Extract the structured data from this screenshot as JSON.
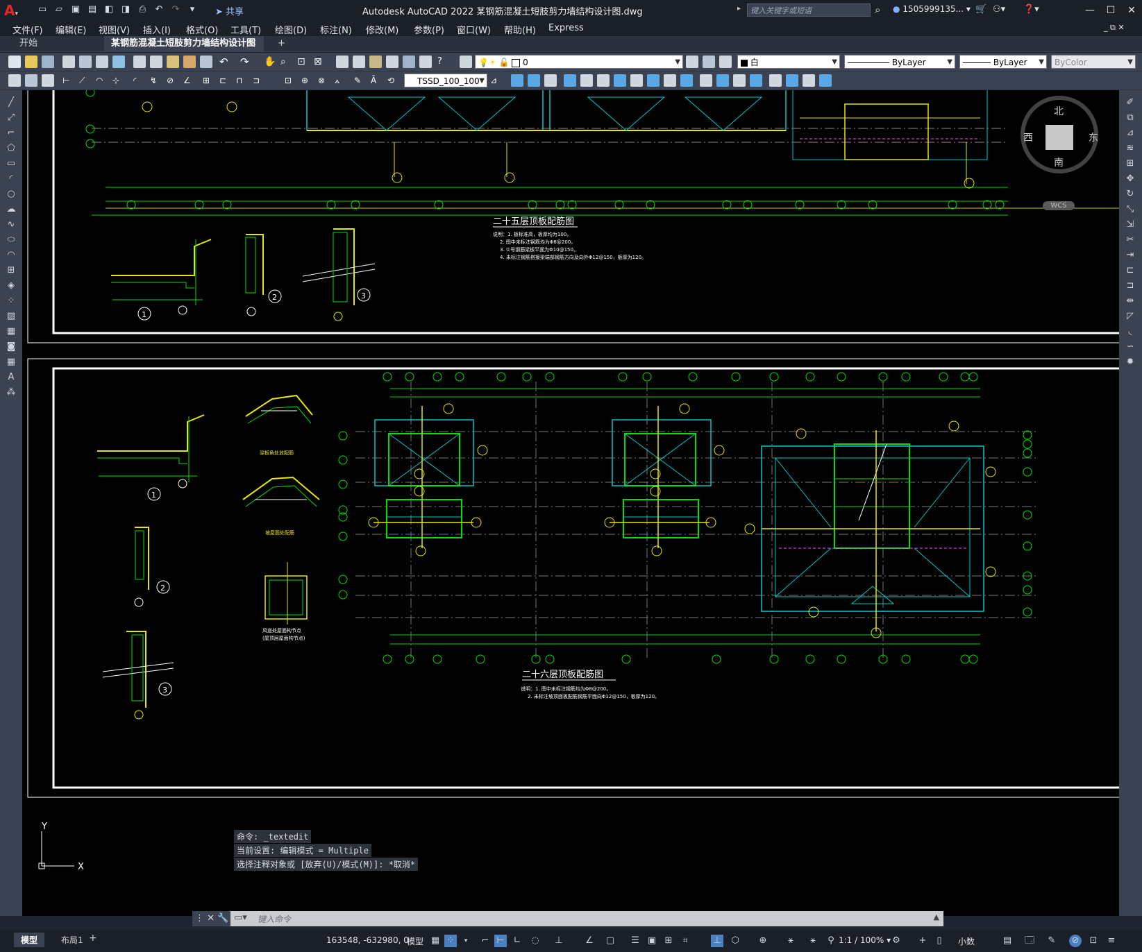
{
  "title_bar": {
    "app_title": "Autodesk AutoCAD 2022    某钢筋混凝土短肢剪力墙结构设计图.dwg",
    "share_label": "共享",
    "search_placeholder": "键入关键字或短语",
    "user": "1505999135... ▾"
  },
  "menu": [
    "文件(F)",
    "编辑(E)",
    "视图(V)",
    "插入(I)",
    "格式(O)",
    "工具(T)",
    "绘图(D)",
    "标注(N)",
    "修改(M)",
    "参数(P)",
    "窗口(W)",
    "帮助(H)",
    "Express"
  ],
  "tabs": {
    "start": "开始",
    "active": "某钢筋混凝土短肢剪力墙结构设计图*",
    "plus": "+"
  },
  "toolbar": {
    "layer": "0",
    "color": "白",
    "linetype": "ByLayer",
    "lineweight": "ByLayer",
    "plotstyle": "ByColor",
    "dimstyle": "TSSD_100_100"
  },
  "viewcube": {
    "north": "北",
    "south": "南",
    "east": "东",
    "west": "西",
    "wcs": "WCS"
  },
  "drawing": {
    "plan_top_title": "二十五层顶板配筋图",
    "plan_top_notes": [
      "说明：1. 板标准高，板厚均为100。",
      "2. 图中未标注钢筋均为Φ8@200。",
      "3. ①号钢筋梁板平面为Φ10@150。",
      "4. 未标注钢筋搭接梁端部钢筋方向及向外Φ12@150，板厚为120。"
    ],
    "plan_bottom_title": "二十六层顶板配筋图",
    "plan_bottom_notes": [
      "说明：1. 图中未标注钢筋均为Φ8@200。",
      "2. 未标注坡顶面板配筋钢筋平面向Φ12@150，板厚为120。"
    ],
    "detail_a": "梁板角处放配筋",
    "detail_b": "坡屋面处配筋",
    "detail_c": "风道处屋面构节点",
    "detail_c2": "(屋顶层屋面构节点)",
    "circle_1": "1",
    "circle_2": "2",
    "circle_3": "3",
    "axis_y": "Y",
    "axis_x": "X"
  },
  "command_history": [
    "命令: _textedit",
    "当前设置: 编辑模式 = Multiple",
    "选择注释对象或 [放弃(U)/模式(M)]: *取消*"
  ],
  "command_placeholder": "键入命令",
  "status_bar": {
    "model_tab": "模型",
    "layout_tab": "布局1",
    "add_tab": "+",
    "coords": "163548, -632980, 0",
    "model_label": "模型",
    "scale": "1:1 / 100% ▾",
    "units": "小数"
  }
}
